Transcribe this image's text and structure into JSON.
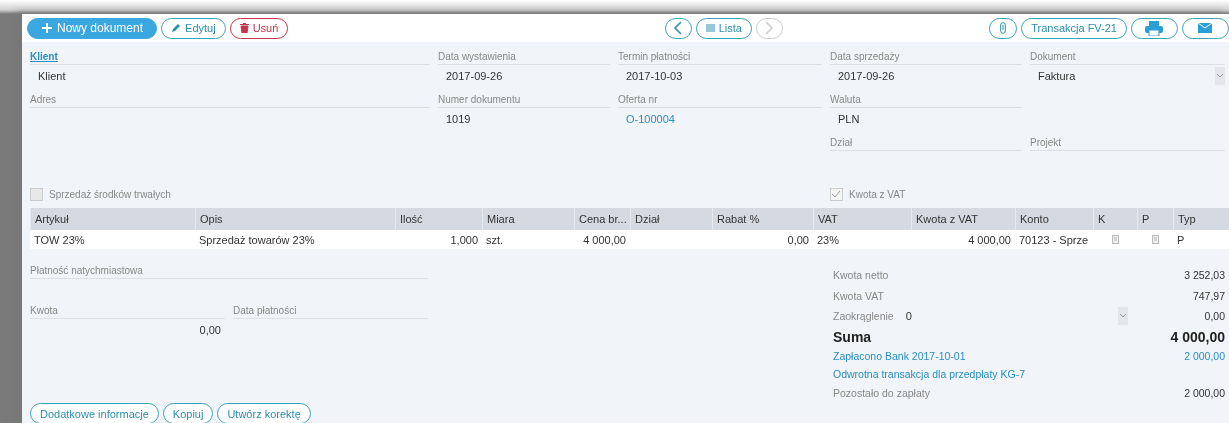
{
  "toolbar": {
    "left": [
      {
        "label": "Nowy dokument",
        "kind": "primary",
        "disabled": false
      },
      {
        "label": "Edytuj",
        "kind": "outline",
        "disabled": false
      },
      {
        "label": "Usuń",
        "kind": "danger",
        "disabled": false
      }
    ],
    "center": [
      {
        "disabled": false
      },
      {
        "label": "Lista",
        "disabled": false
      },
      {
        "disabled": true
      }
    ],
    "right": [
      {
        "disabled": false
      },
      {
        "label": "Transakcja FV-21",
        "disabled": false
      },
      {
        "disabled": false
      },
      {
        "disabled": false
      }
    ]
  },
  "form": {
    "client": {
      "label": "Klient",
      "value": "Klient",
      "kind": "link-label"
    },
    "issue_date": {
      "label": "Data wystawienia",
      "value": "2017-09-26"
    },
    "due_date": {
      "label": "Termin płatności",
      "value": "2017-10-03"
    },
    "sale_date": {
      "label": "Data sprzedaży",
      "value": "2017-09-26"
    },
    "document": {
      "label": "Dokument",
      "value": "Faktura",
      "kind": "select"
    },
    "address": {
      "label": "Adres"
    },
    "number": {
      "label": "Numer dokumentu",
      "value": "1019"
    },
    "offer": {
      "label": "Oferta nr",
      "value": "O-100004",
      "kind": "link"
    },
    "currency": {
      "label": "Waluta",
      "value": "PLN"
    },
    "department": {
      "label": "Dział"
    },
    "project": {
      "label": "Projekt"
    },
    "fixed_assets": {
      "label": "Sprzedaż środków trwałych",
      "checked": false
    },
    "gross": {
      "label": "Kwota z VAT",
      "checked": true
    }
  },
  "table": {
    "columns": [
      "Artykuł",
      "Opis",
      "Ilość",
      "Miara",
      "Cena br...",
      "Dział",
      "Rabat %",
      "VAT",
      "Kwota z VAT",
      "Konto",
      "K",
      "P",
      "Typ"
    ],
    "rows": [
      {
        "cells": [
          "TOW 23%",
          "Sprzedaż towarów 23%",
          "1,000",
          "szt.",
          "4 000,00",
          "",
          "0,00",
          "23%",
          "4 000,00",
          "70123 - Sprze",
          "",
          "",
          "P"
        ]
      }
    ]
  },
  "payment": {
    "label": "Płatność natychmiastowa",
    "amount_label": "Kwota",
    "amount": "0,00",
    "date_label": "Data płatności"
  },
  "summary": [
    {
      "kind": "plain",
      "label": "Kwota netto",
      "value": "3 252,03"
    },
    {
      "kind": "plain",
      "label": "Kwota VAT",
      "value": "747,97"
    },
    {
      "kind": "select",
      "label": "Zaokrąglenie",
      "select": "0",
      "value": "0,00"
    },
    {
      "kind": "total",
      "label": "Suma",
      "value": "4 000,00"
    },
    {
      "kind": "link",
      "label": "Zapłacono Bank 2017-10-01",
      "value": "2 000,00"
    },
    {
      "kind": "link",
      "label": "Odwrotna transakcja dla przedpłaty KG-7"
    },
    {
      "kind": "plain",
      "label": "Pozostało do zapłaty",
      "value": "2 000,00"
    }
  ],
  "bottom": [
    "Dodatkowe informacje",
    "Kopiuj",
    "Utwórz korektę"
  ]
}
